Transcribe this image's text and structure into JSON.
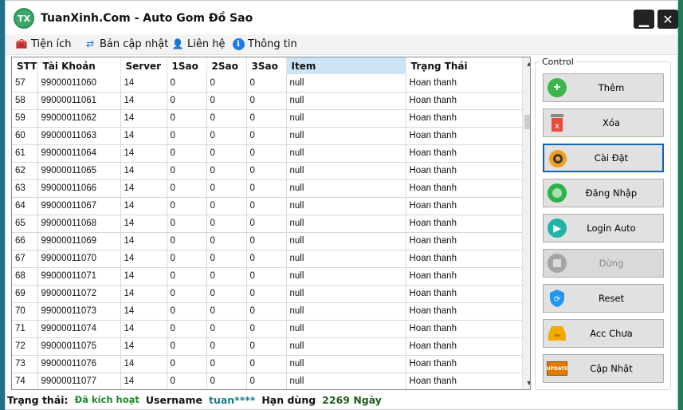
{
  "window": {
    "title": "TuanXinh.Com - Auto Gom Đồ Sao",
    "logo_text": "TX"
  },
  "menu": [
    {
      "icon": "toolbox-icon",
      "label": "Tiện ích"
    },
    {
      "icon": "refresh-icon",
      "label": "Bản cập nhật"
    },
    {
      "icon": "person-icon",
      "label": "Liên hệ"
    },
    {
      "icon": "info-icon",
      "label": "Thông tin"
    }
  ],
  "table": {
    "columns": [
      "STT",
      "Tài Khoản",
      "Server",
      "1Sao",
      "2Sao",
      "3Sao",
      "Item",
      "Trạng Thái"
    ],
    "selected_column": "Item",
    "rows": [
      [
        "57",
        "99000011060",
        "14",
        "0",
        "0",
        "0",
        "null",
        "Hoan thanh"
      ],
      [
        "58",
        "99000011061",
        "14",
        "0",
        "0",
        "0",
        "null",
        "Hoan thanh"
      ],
      [
        "59",
        "99000011062",
        "14",
        "0",
        "0",
        "0",
        "null",
        "Hoan thanh"
      ],
      [
        "60",
        "99000011063",
        "14",
        "0",
        "0",
        "0",
        "null",
        "Hoan thanh"
      ],
      [
        "61",
        "99000011064",
        "14",
        "0",
        "0",
        "0",
        "null",
        "Hoan thanh"
      ],
      [
        "62",
        "99000011065",
        "14",
        "0",
        "0",
        "0",
        "null",
        "Hoan thanh"
      ],
      [
        "63",
        "99000011066",
        "14",
        "0",
        "0",
        "0",
        "null",
        "Hoan thanh"
      ],
      [
        "64",
        "99000011067",
        "14",
        "0",
        "0",
        "0",
        "null",
        "Hoan thanh"
      ],
      [
        "65",
        "99000011068",
        "14",
        "0",
        "0",
        "0",
        "null",
        "Hoan thanh"
      ],
      [
        "66",
        "99000011069",
        "14",
        "0",
        "0",
        "0",
        "null",
        "Hoan thanh"
      ],
      [
        "67",
        "99000011070",
        "14",
        "0",
        "0",
        "0",
        "null",
        "Hoan thanh"
      ],
      [
        "68",
        "99000011071",
        "14",
        "0",
        "0",
        "0",
        "null",
        "Hoan thanh"
      ],
      [
        "69",
        "99000011072",
        "14",
        "0",
        "0",
        "0",
        "null",
        "Hoan thanh"
      ],
      [
        "70",
        "99000011073",
        "14",
        "0",
        "0",
        "0",
        "null",
        "Hoan thanh"
      ],
      [
        "71",
        "99000011074",
        "14",
        "0",
        "0",
        "0",
        "null",
        "Hoan thanh"
      ],
      [
        "72",
        "99000011075",
        "14",
        "0",
        "0",
        "0",
        "null",
        "Hoan thanh"
      ],
      [
        "73",
        "99000011076",
        "14",
        "0",
        "0",
        "0",
        "null",
        "Hoan thanh"
      ],
      [
        "74",
        "99000011077",
        "14",
        "0",
        "0",
        "0",
        "null",
        "Hoan thanh"
      ]
    ]
  },
  "control": {
    "group_label": "Control",
    "buttons": [
      {
        "name": "add-button",
        "icon": "plus-icon",
        "label": "Thêm",
        "color": "#3cb54a"
      },
      {
        "name": "delete-button",
        "icon": "trash-icon",
        "label": "Xóa",
        "color": "#e84b3c"
      },
      {
        "name": "settings-button",
        "icon": "gear-icon",
        "label": "Cài Đặt",
        "color": "#f0a020"
      },
      {
        "name": "login-button",
        "icon": "record-icon",
        "label": "Đăng Nhập",
        "color": "#2fb14a"
      },
      {
        "name": "login-auto-button",
        "icon": "play-icon",
        "label": "Login Auto",
        "color": "#21b3a4"
      },
      {
        "name": "stop-button",
        "icon": "stop-icon",
        "label": "Dừng",
        "color": "#9a9a9a"
      },
      {
        "name": "reset-button",
        "icon": "shield-refresh-icon",
        "label": "Reset",
        "color": "#2196f3"
      },
      {
        "name": "accounts-button",
        "icon": "inbox-icon",
        "label": "Acc Chưa",
        "color": "#f2a900"
      },
      {
        "name": "update-button",
        "icon": "update-badge-icon",
        "label": "Cập Nhật",
        "color": "#e07b00",
        "badge": "UPDATE"
      }
    ]
  },
  "status": {
    "label": "Trạng thái:",
    "value": "Đã kích hoạt",
    "username_label": "Username",
    "username": "tuan****",
    "expiry_label": "Hạn dùng",
    "expiry": "2269 Ngày"
  }
}
